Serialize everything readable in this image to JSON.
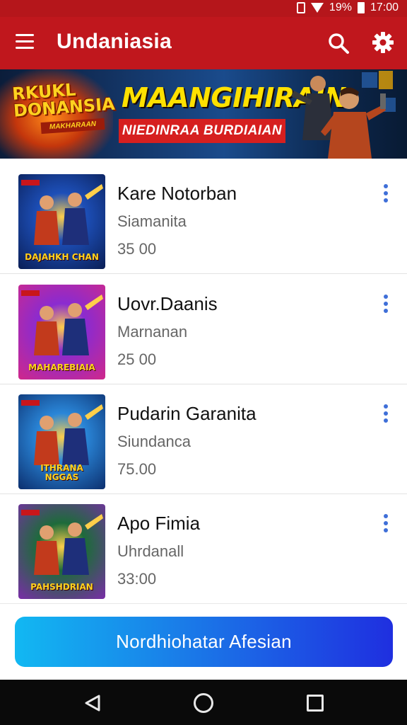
{
  "status_bar": {
    "battery": "19%",
    "time": "17:00"
  },
  "app_bar": {
    "title": "Undaniasia"
  },
  "banner": {
    "logo_text": "RKUKL DONANSIA",
    "logo_tag": "MAKHARAAN",
    "headline": "MAANGIHIRAIN",
    "subheadline": "NIEDINRAA BURDIAIAN"
  },
  "items": [
    {
      "title": "Kare Notorban",
      "subtitle": "Siamanita",
      "price": "35 00",
      "thumb_label": "DAJAHKH CHAN",
      "colors": [
        "#1d4fb8",
        "#0a1e55"
      ]
    },
    {
      "title": "Uovr.Daanis",
      "subtitle": "Marnanan",
      "price": "25 00",
      "thumb_label": "MAHAREBIAIA",
      "colors": [
        "#8a2bd0",
        "#d0288a"
      ]
    },
    {
      "title": "Pudarin Garanita",
      "subtitle": "Siundanca",
      "price": "75.00",
      "thumb_label": "ITHRANA NGGAS",
      "colors": [
        "#2a86d8",
        "#0c2f6e"
      ]
    },
    {
      "title": "Apo Fimia",
      "subtitle": "Uhrdanall",
      "price": "33:00",
      "thumb_label": "PAHSHDRIAN",
      "colors": [
        "#1d6b3a",
        "#7a2da8"
      ]
    }
  ],
  "cta": {
    "label": "Nordhiohatar Afesian"
  },
  "theme": {
    "primary": "#c0171d",
    "accent": "#3f6fd8",
    "cta_start": "#12b8f2",
    "cta_end": "#1f2fe0"
  }
}
